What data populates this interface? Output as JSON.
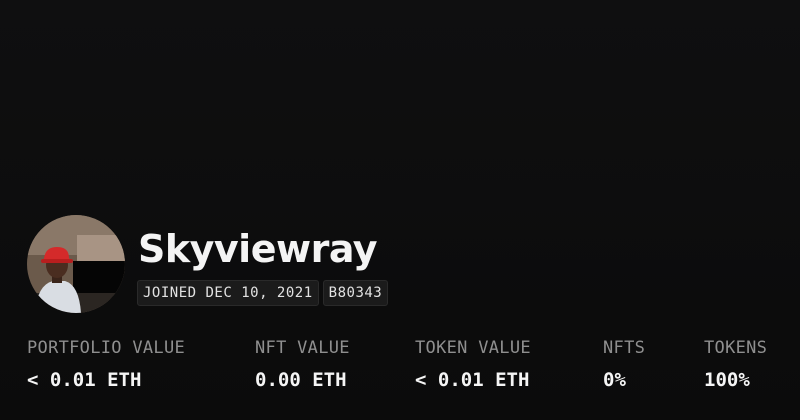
{
  "profile": {
    "name": "Skyviewray",
    "joined": "JOINED DEC 10, 2021",
    "id_badge": "B80343"
  },
  "stats": [
    {
      "label": "PORTFOLIO VALUE",
      "value": "< 0.01 ETH"
    },
    {
      "label": "NFT VALUE",
      "value": "0.00 ETH"
    },
    {
      "label": "TOKEN VALUE",
      "value": "< 0.01 ETH"
    },
    {
      "label": "NFTS",
      "value": "0%"
    },
    {
      "label": "TOKENS",
      "value": "100%"
    }
  ],
  "colors": {
    "background": "#0b0b0b",
    "text": "#f2f2f2",
    "muted": "#8f8f8f",
    "badge_bg": "#1b1b1b"
  },
  "icons": {
    "avatar": "user-avatar-photo"
  }
}
